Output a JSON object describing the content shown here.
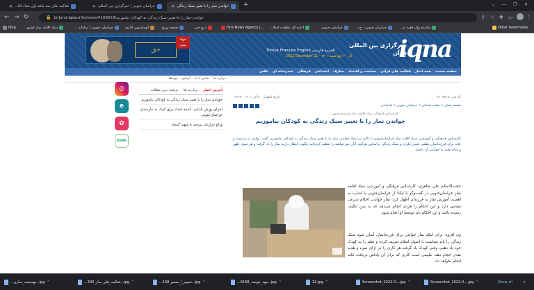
{
  "browser": {
    "tabs": [
      {
        "title": "فعالیت های سه ماهه اول ستاد اقا..."
      },
      {
        "title": "خراسان جنوبی | خبرگزاری بین المللی"
      },
      {
        "title": "خواندن نماز را با تغییر سبک زندگی"
      }
    ],
    "new_tab": "+",
    "url_host": "iqna.ir",
    "url_scheme_prefix": "birjand.",
    "url_path": "/fa/news/4108618/خواندن-نماز-را-با-تغییر-سبک-زندگی-به-کودکان-بیاموزیم",
    "bookmarks": [
      {
        "label": "Ping"
      },
      {
        "label": "ستاد اقامه نماز کشور"
      },
      {
        "label": "خراسان جنوبی | سامانه..."
      },
      {
        "label": "اتوماسیون اداری"
      },
      {
        "label": "صفحه ورود"
      },
      {
        "label": "درج خبر"
      },
      {
        "label": "Fars News Agency |..."
      },
      {
        "label": "اداره کل تبلیغات اسلا..."
      },
      {
        "label": "خراسان جنوبی"
      },
      {
        "label": "خراسان جنوبی - ج..."
      },
      {
        "label": "نماینده ولی فقیه در..."
      }
    ],
    "other_bookmarks": "Other bookmarks"
  },
  "site": {
    "logo": "iqna",
    "logo_text": "خبرگزاری بین المللی قرآن",
    "languages": "Türkçe  Français  English  العربية  فارسی",
    "header_date": "2022 December 21 - ۱۴۰۱ آذر ۳۰ چهارشنبه",
    "banner_script": "حق",
    "banner_badge": "جهاد تبیین",
    "nav": [
      "صفحه نخست",
      "همه اخبار",
      "فعالیت های قرآنی",
      "سیاست و اقتصاد",
      "معارف",
      "اجتماعی",
      "فرهنگی",
      "چندرسانه ای",
      "عکس"
    ],
    "subnav": [
      "درباره ما",
      "تماس با ما",
      "آرشیو",
      "پیوندها"
    ]
  },
  "sidebar": {
    "tabs": [
      "آخرین اخبار",
      "پربازدید ها",
      "پربحث ترین مطالب"
    ],
    "items": [
      "خواندن نماز را با تغییر سبک زندگی به کودکان بیاموزیم",
      "اجرای پویش یلدایی، کمیته امداد برای کمک به نیازمندان خراسان‌جنوبی",
      "وداع بازاریان بیرجند با شهید گمنام"
    ],
    "social_labels": [
      "instagram",
      "eitaa",
      "aparat",
      "iqna"
    ]
  },
  "article": {
    "code": "کد خبر: ۴۱۰۸۶۱۸",
    "date": "تاریخ انتشار: ۳۰ آذر ۱۴۰۱ - ۰۹:۴۷",
    "breadcrumb": "صفحه اصلی » شعب استانی » خراسان جنوبی » اجتماعی",
    "surtitle": "کارشناس فرهنگی ستاد اقامه نماز خراسان‌جنوبی:",
    "title": "خواندن نماز را با تغییر سبک زندگی به کودکان بیاموزیم",
    "lead": "کارشناس فرهنگی و آموزشی ستاد اقامه نماز خراسان‌جنوبی با تاکید بر اینکه خواندن نماز را با تغییر سبک زندگی به کودکان بیاموزیم، گفت: وقتی در مدرسه و خانه برای فرزندانمان نظمی تعیین نکرده و سبک زندگی براساس هرآنچه آنان می‌خواهند را تنظیم کرده‌ایم چگونه انتظار داریم نماز را یاد گرفته و هر صبح، ظهر و شام مقید به خواندن آن باشند.",
    "body1": "حجت‌الاسلام علی طاهری، کارشناس فرهنگی و آموزشی ستاد اقامه نماز خراسان‌جنوبی در گفت‌وگو با ایکنا از خراسان‌جنوبی با اشاره به اهمیت آموزش نماز به فرزندان اظهار کرد: نماز خواندن احکام شرعی مقدس دارد و این احکام را فردی انجام می‌دهد که به سن تکلیف رسیده باشد و این کار را از فرزند خود باید بخواهیم که به این احکام عمل کند و این احکام را تا حد امکان پایدار کند تا در بلوغ توسط او به درستی انجام شود.",
    "body1_short": "حجت‌الاسلام علی طاهری، کارشناس فرهنگی و آموزشی ستاد اقامه نماز خراسان‌جنوبی در گفت‌وگو با ایکنا از خراسان‌جنوبی با اشاره به اهمیت آموزش نماز به فرزندان اظهار کرد: نماز خواندن احکام شرعی مقدس دارد و این احکام را فردی انجام می‌دهد که به سن تکلیف رسیده باشد و این احکام باید توسط او انجام شود.",
    "body2": "وی افزود: برای اینکه نماز خواندن برای فرزندانمان آسان شود سبک زندگی را باید متناسب با اصول اسلام تعریف کرده و نظم را به کودک خود یاد دهیم، وقتی کودک یاد گرفته هر کاری را در ازای نمره و هدیه نقدی انجام دهد، طبیعی است کاری که برای آن پاداش دریافت نکند انجام نخواهد داد."
  },
  "downloads": {
    "items": [
      "...بهمنست_ساری...jpg",
      "...فعالیت_های_نماز_300...jpg",
      "...تصویر_ا_مسیو_168...jpg",
      "...6مهد_خوسته_168...jpg",
      "12.jpg",
      "Screenshot_2022-0....jpg",
      "Screenshot_2022-0....jpg"
    ],
    "show_all": "Show all",
    "close": "✕"
  }
}
